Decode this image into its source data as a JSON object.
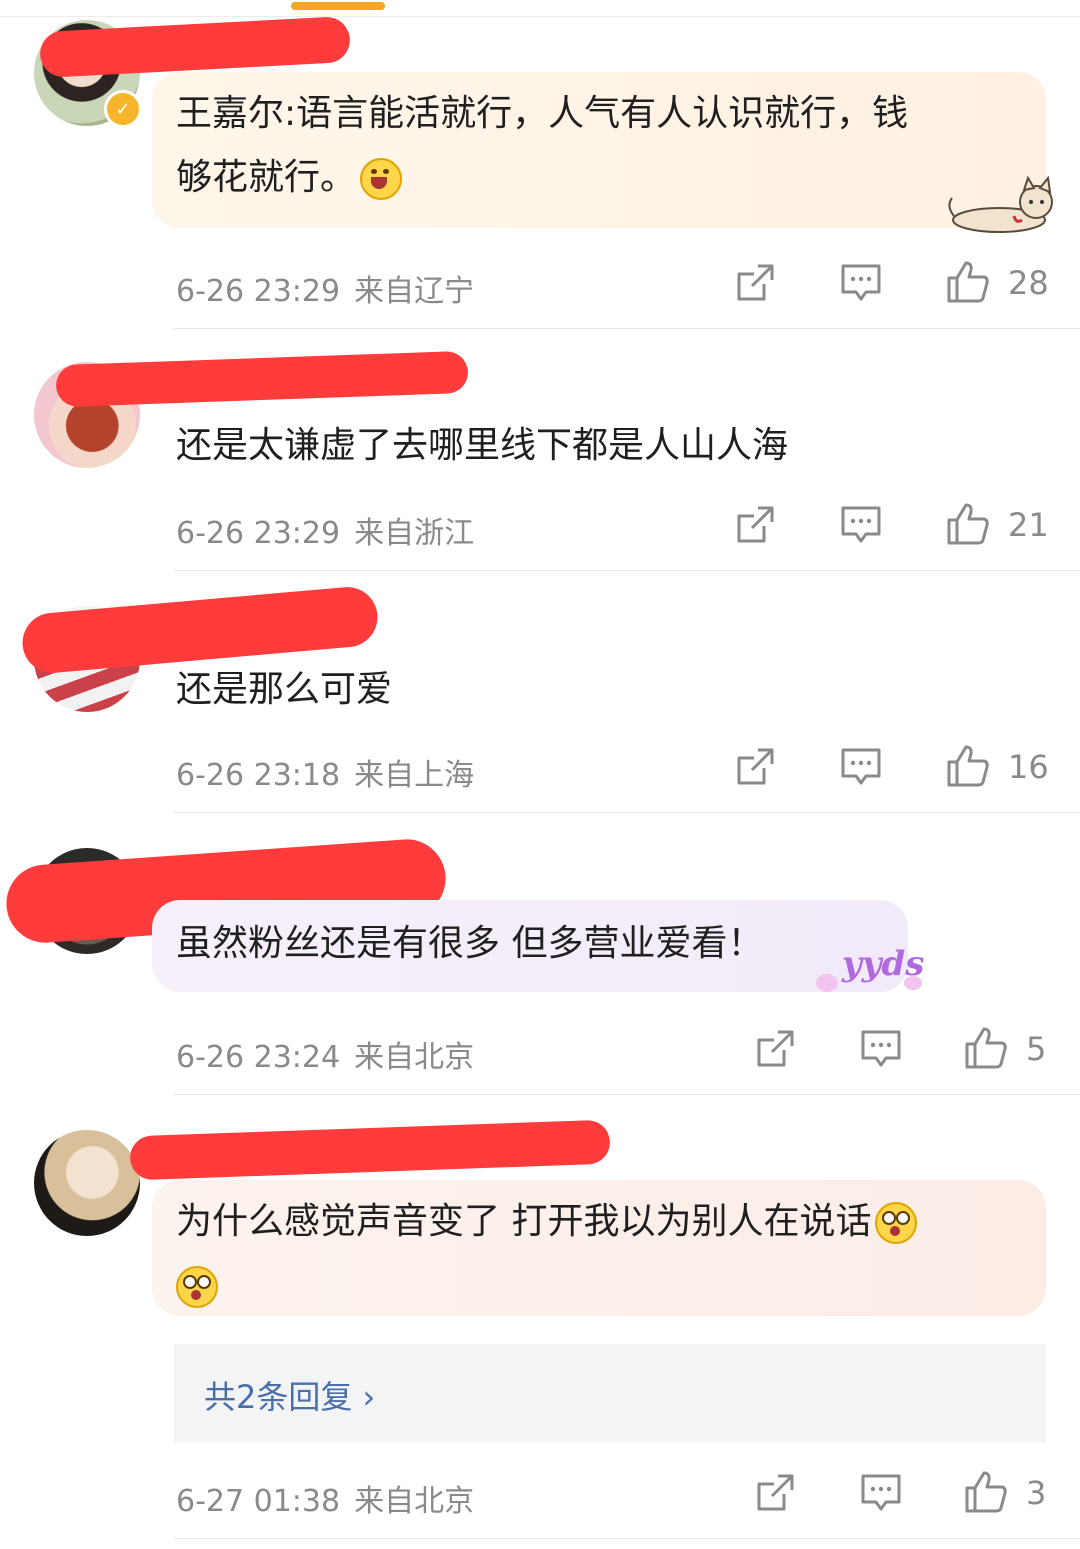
{
  "comments": [
    {
      "text_lines": [
        "王嘉尔:语言能活就行，人气有人认识就行，钱",
        "够花就行。"
      ],
      "emoji": "grin-emoji",
      "date": "6-26 23:29",
      "location": "来自辽宁",
      "likes": "28",
      "verified": true,
      "sticker": "cat-sticker"
    },
    {
      "text_lines": [
        "还是太谦虚了去哪里线下都是人山人海"
      ],
      "date": "6-26 23:29",
      "location": "来自浙江",
      "likes": "21"
    },
    {
      "text_lines": [
        "还是那么可爱"
      ],
      "date": "6-26 23:18",
      "location": "来自上海",
      "likes": "16"
    },
    {
      "text_lines": [
        "虽然粉丝还是有很多 但多营业爱看！"
      ],
      "date": "6-26 23:24",
      "location": "来自北京",
      "likes": "5",
      "sticker": "yyds-sticker",
      "sticker_text": "yyds"
    },
    {
      "text_lines": [
        "为什么感觉声音变了 打开我以为别人在说话"
      ],
      "emoji": "shocked-emoji",
      "date": "6-27 01:38",
      "location": "来自北京",
      "likes": "3",
      "replies": "共2条回复 ›"
    }
  ],
  "colors": {
    "accent": "#f5a623",
    "redaction": "#ff3b3b",
    "meta": "#8a8a8a",
    "link": "#4a6fa8"
  }
}
